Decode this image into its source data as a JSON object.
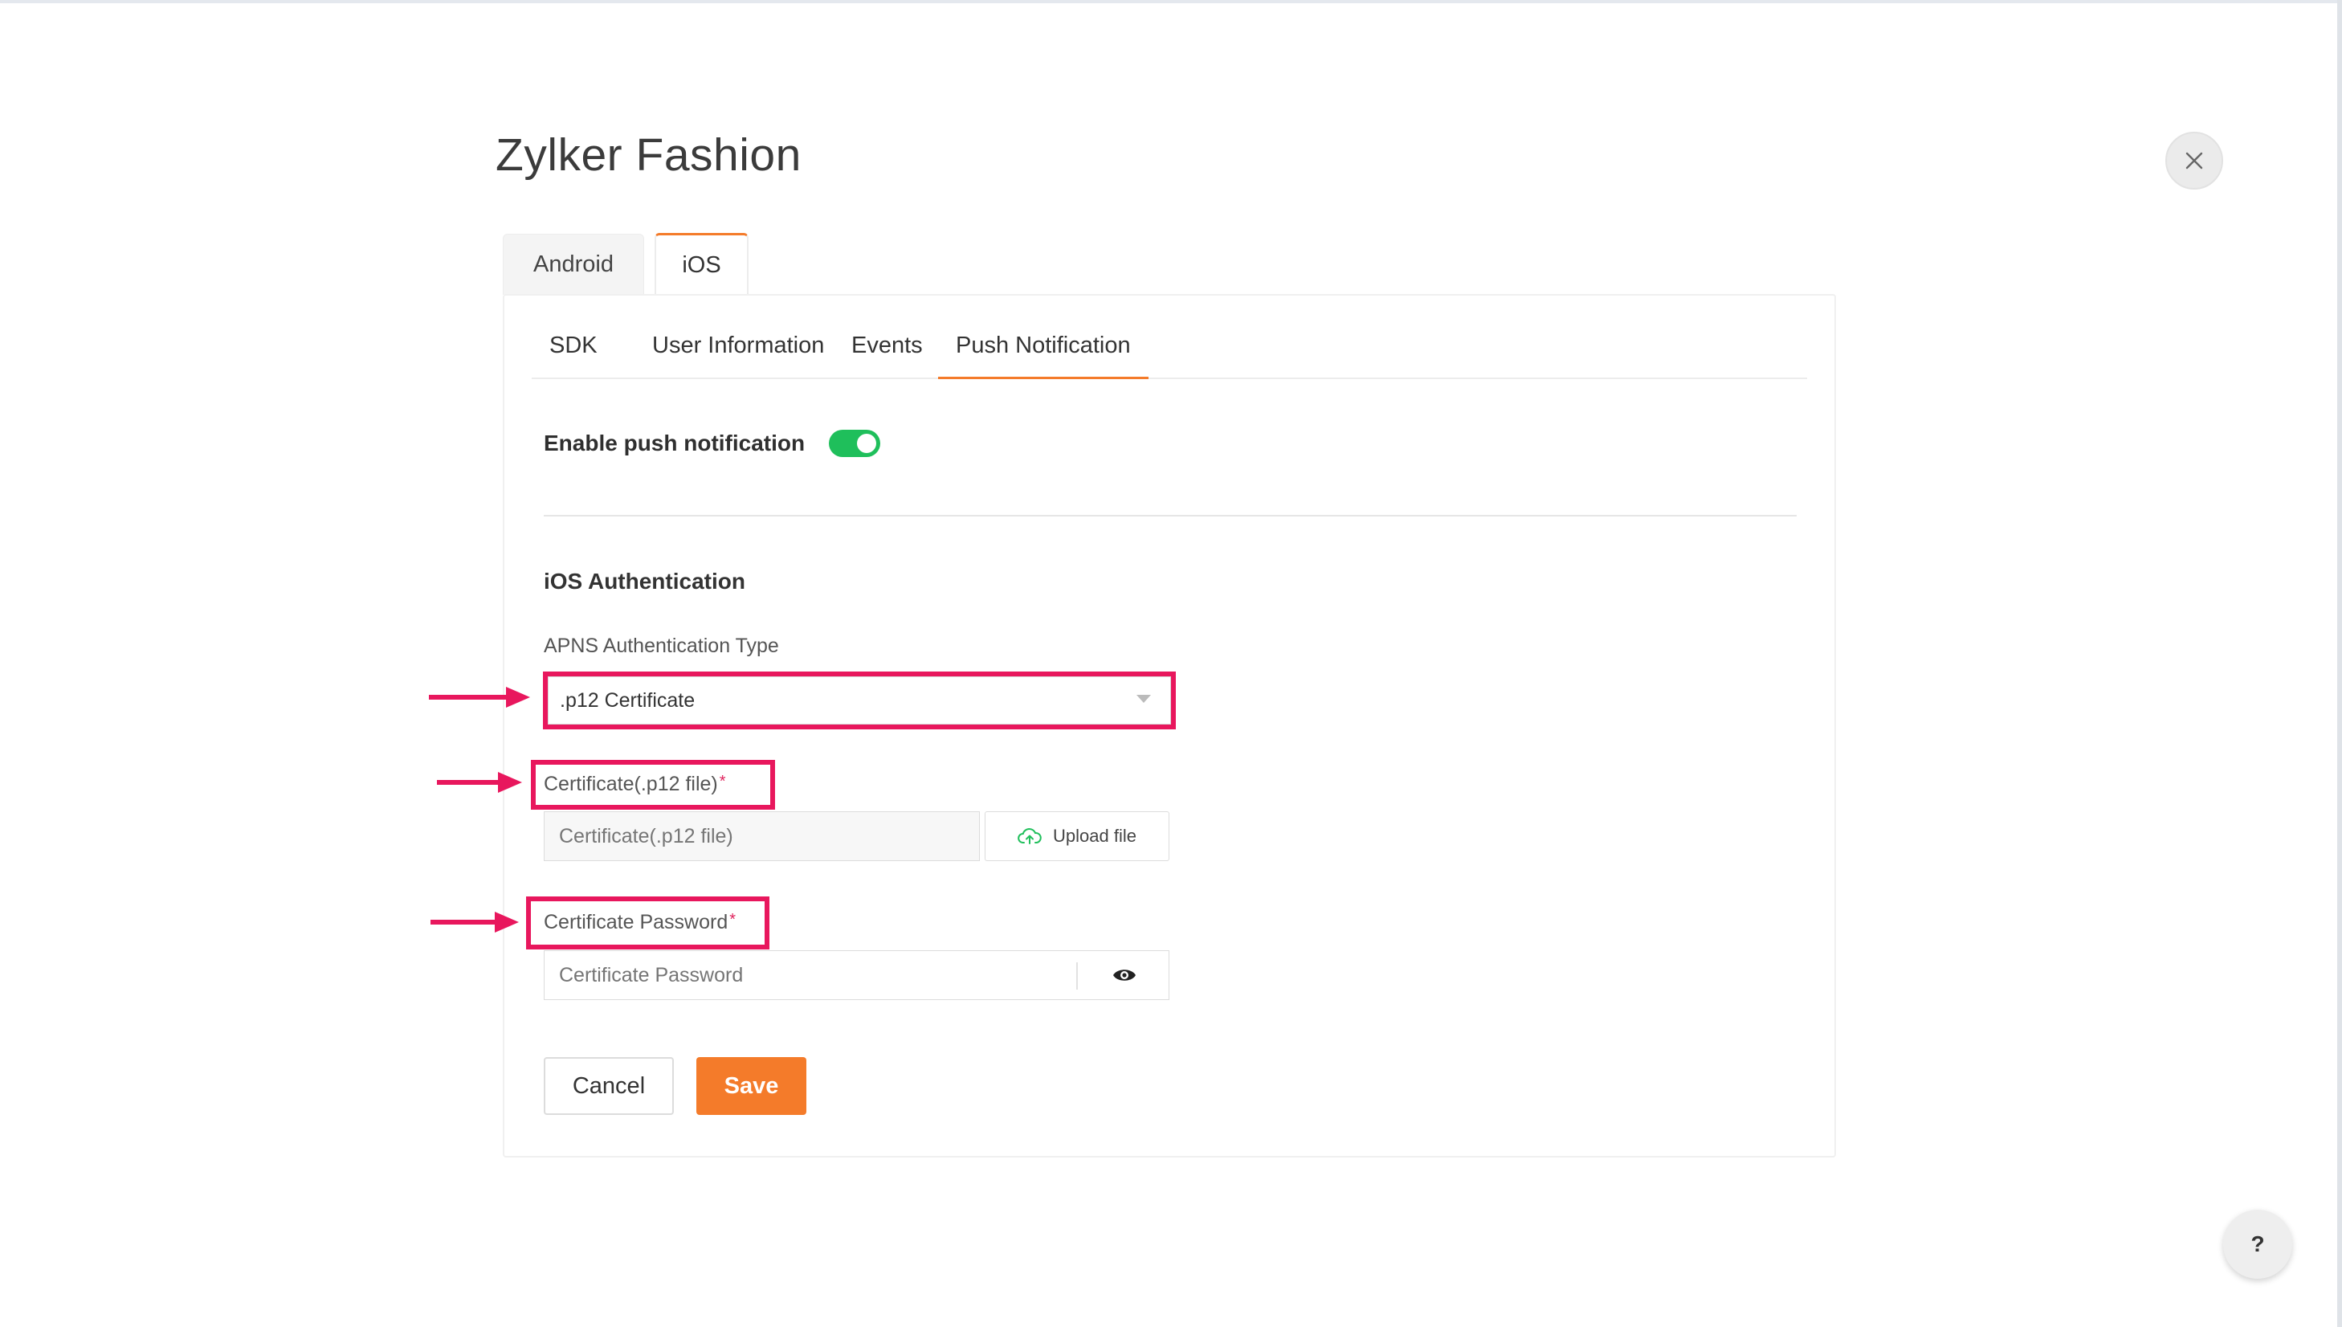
{
  "app": {
    "title": "Zylker Fashion"
  },
  "platform_tabs": [
    {
      "label": "Android",
      "active": false
    },
    {
      "label": "iOS",
      "active": true
    }
  ],
  "section_tabs": [
    {
      "label": "SDK",
      "active": false
    },
    {
      "label": "User Information",
      "active": false
    },
    {
      "label": "Events",
      "active": false
    },
    {
      "label": "Push Notification",
      "active": true
    }
  ],
  "push": {
    "label": "Enable push notification",
    "enabled": true
  },
  "auth": {
    "title": "iOS Authentication",
    "type_label": "APNS Authentication Type",
    "type_value": ".p12 Certificate",
    "cert_label": "Certificate(.p12 file)",
    "cert_placeholder": "Certificate(.p12 file)",
    "upload_label": "Upload file",
    "password_label": "Certificate Password",
    "password_placeholder": "Certificate Password",
    "required_mark": "*"
  },
  "actions": {
    "cancel": "Cancel",
    "save": "Save"
  },
  "help": {
    "label": "?"
  },
  "colors": {
    "accent": "#f47b2a",
    "toggle_on": "#1fbf5b",
    "highlight": "#e8175d"
  }
}
